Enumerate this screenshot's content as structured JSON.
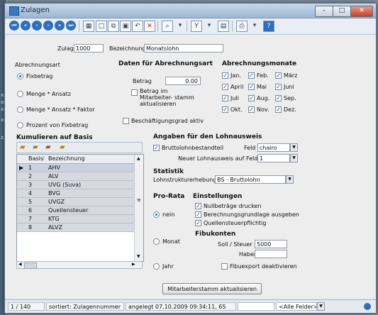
{
  "window": {
    "title": "Zulagen"
  },
  "form": {
    "zulage_label": "Zulage",
    "zulage_value": "1000",
    "bezeichnung_label": "Bezeichnung",
    "bezeichnung_value": "Monatslohn"
  },
  "abrechnungsart": {
    "heading": "Abrechnungsart",
    "options": [
      "Fixbetrag",
      "Menge * Ansatz",
      "Menge * Ansatz * Faktor",
      "Prozent von Fixbetrag"
    ],
    "selected": 0
  },
  "daten": {
    "heading": "Daten für Abrechnungsart",
    "betrag_label": "Betrag",
    "betrag_value": "0.00",
    "betrag_stamm_label": "Betrag im Mitarbeiter- stamm aktualisieren",
    "beschaeftigungsgrad_label": "Beschäftigungsgrad aktiv"
  },
  "monate": {
    "heading": "Abrechnungsmonate",
    "items": [
      "Jan.",
      "Feb.",
      "März",
      "April",
      "Mai",
      "Juni",
      "Juli",
      "Aug.",
      "Sep.",
      "Okt.",
      "Nov.",
      "Dez."
    ]
  },
  "kumulieren": {
    "heading": "Kumulieren auf Basis",
    "columns": [
      "Basis",
      "Bezeichnung"
    ],
    "rows": [
      {
        "basis": "1",
        "bezeichnung": "AHV"
      },
      {
        "basis": "2",
        "bezeichnung": "ALV"
      },
      {
        "basis": "3",
        "bezeichnung": "UVG (Suva)"
      },
      {
        "basis": "4",
        "bezeichnung": "BVG"
      },
      {
        "basis": "5",
        "bezeichnung": "UVGZ"
      },
      {
        "basis": "6",
        "bezeichnung": "Quellensteuer"
      },
      {
        "basis": "7",
        "bezeichnung": "KTG"
      },
      {
        "basis": "8",
        "bezeichnung": "ALVZ"
      }
    ]
  },
  "lohnausweis": {
    "heading": "Angaben für den Lohnausweis",
    "bruttolohn_label": "Bruttolohnbestandteil",
    "feld_label": "Feld",
    "feld_value": "chairo",
    "neuer_label": "Neuer Lohnausweis auf Feld",
    "neuer_value": "1"
  },
  "statistik": {
    "heading": "Statistik",
    "label": "Lohnstrukturerhebung",
    "value": "BS - Bruttolohn"
  },
  "prorata": {
    "heading": "Pro-Rata",
    "options": [
      "nein",
      "Monat",
      "Jahr"
    ],
    "selected": 0
  },
  "einstellungen": {
    "heading": "Einstellungen",
    "items": [
      "Nullbeträge drucken",
      "Berechnungsgrundlage ausgeben",
      "Quellensteuerpflichtig"
    ]
  },
  "fibukonten": {
    "heading": "Fibukonten",
    "soll_label": "Soll / Steuer",
    "soll_value": "5000",
    "haben_label": "Haben",
    "haben_value": "",
    "export_label": "Fibuexport deaktivieren"
  },
  "buttons": {
    "update": "Mitarbeiterstamm aktualisieren"
  },
  "status": {
    "records": "1 / 140",
    "sort": "sortiert: Zulagennummer",
    "created": "angelegt 07.10.2009 09:34:11, 65",
    "fields": "<Alle Felder>"
  },
  "colors": {
    "accent": "#2e6fbc",
    "title_bg": "#9db6d2"
  }
}
